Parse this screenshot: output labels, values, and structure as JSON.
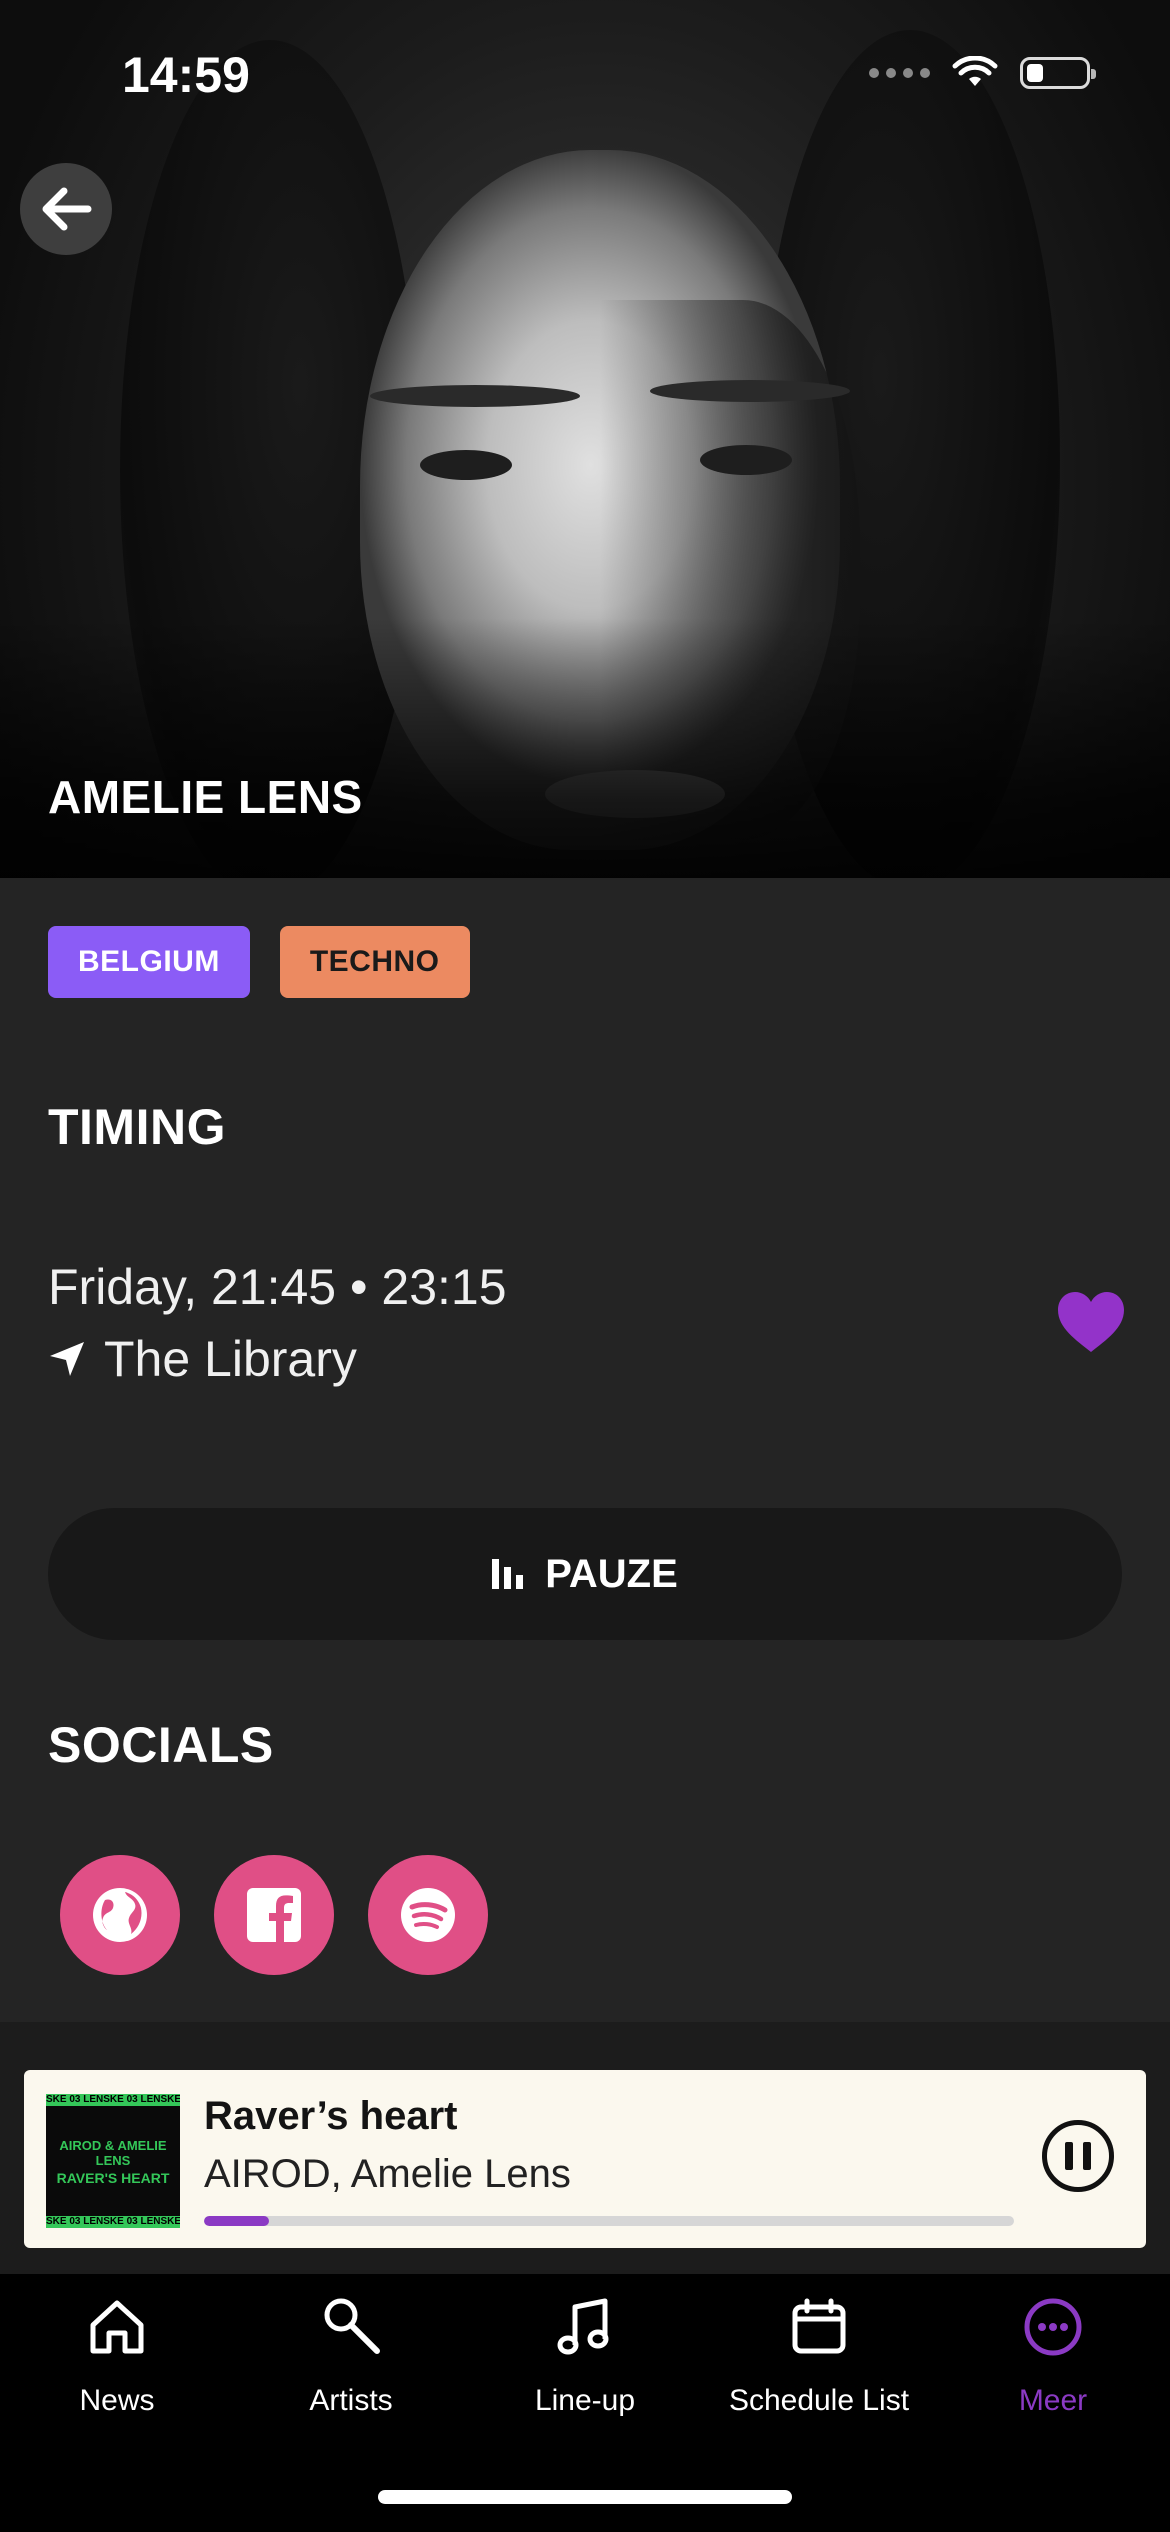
{
  "status_bar": {
    "time": "14:59"
  },
  "artist": {
    "name": "AMELIE LENS"
  },
  "tags": {
    "country": "BELGIUM",
    "genre": "TECHNO"
  },
  "timing": {
    "title": "TIMING",
    "when": "Friday, 21:45 • 23:15",
    "stage": "The Library"
  },
  "pause_button": {
    "label": "PAUZE"
  },
  "socials": {
    "title": "SOCIALS",
    "items": [
      "globe-icon",
      "facebook-icon",
      "spotify-icon"
    ]
  },
  "player": {
    "cover": {
      "strip_text": "SKE 03 LENSKE 03 LENSKE 03",
      "line1": "AIROD & AMELIE LENS",
      "line2": "RAVER'S HEART"
    },
    "title": "Raver’s heart",
    "artists": "AIROD, Amelie Lens",
    "progress_percent": 8
  },
  "tabs": [
    {
      "label": "News",
      "icon": "home-icon",
      "active": false
    },
    {
      "label": "Artists",
      "icon": "microphone-icon",
      "active": false
    },
    {
      "label": "Line-up",
      "icon": "music-note-icon",
      "active": false
    },
    {
      "label": "Schedule List",
      "icon": "calendar-icon",
      "active": false
    },
    {
      "label": "Meer",
      "icon": "more-icon",
      "active": true
    }
  ],
  "colors": {
    "accent": "#8b3ac4",
    "country_tag": "#8b5cf6",
    "genre_tag": "#ec8a61",
    "social": "#e04f86",
    "heart": "#9333c9"
  }
}
